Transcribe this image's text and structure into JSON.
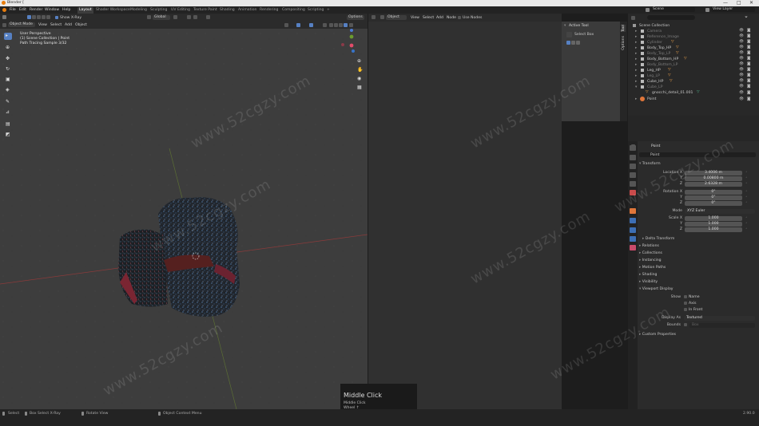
{
  "window": {
    "title": "Blender [",
    "controls": [
      "—",
      "□",
      "✕"
    ]
  },
  "menu": {
    "items": [
      "File",
      "Edit",
      "Render",
      "Window",
      "Help"
    ],
    "workspaces": [
      "Layout",
      "Shader Workspace",
      "Modeling",
      "Sculpting",
      "UV Editing",
      "Texture Paint",
      "Shading",
      "Animation",
      "Rendering",
      "Compositing",
      "Scripting",
      "+"
    ],
    "scene": "Scene",
    "view_layer": "View Layer"
  },
  "toolsettings": {
    "show_xray": "Show X-Ray",
    "transform": "Global",
    "options": "Options"
  },
  "viewport": {
    "mode": "Object Mode",
    "menus": [
      "View",
      "Select",
      "Add",
      "Object"
    ],
    "overlay_lines": [
      "User Perspective",
      "(1) Scene Collection | Point",
      "Path Tracing Sample 3/32"
    ]
  },
  "editor2": {
    "mode": "Object",
    "menus": [
      "View",
      "Select",
      "Add",
      "Node"
    ],
    "use_nodes": "Use Nodes"
  },
  "active_tool": {
    "title": "Active Tool",
    "tool_name": "Select Box",
    "tabs": [
      "Tool",
      "Options"
    ]
  },
  "outliner": {
    "items": [
      {
        "name": "Scene Collection",
        "depth": 0
      },
      {
        "name": "Camera",
        "depth": 1
      },
      {
        "name": "Reference_Image",
        "depth": 1
      },
      {
        "name": "Cylinder",
        "depth": 1
      },
      {
        "name": "Body_Top_HP",
        "depth": 1
      },
      {
        "name": "Body_Top_LP",
        "depth": 1
      },
      {
        "name": "Body_Bottom_HP",
        "depth": 1
      },
      {
        "name": "Body_Bottom_LP",
        "depth": 1
      },
      {
        "name": "Leg_HP",
        "depth": 1
      },
      {
        "name": "Leg_LP",
        "depth": 1
      },
      {
        "name": "Cube_HP",
        "depth": 1
      },
      {
        "name": "Cube_LP",
        "depth": 1
      },
      {
        "name": "gnocchi_detail_01.001",
        "depth": 2
      },
      {
        "name": "Point",
        "depth": 0
      }
    ]
  },
  "properties": {
    "object_name": "Point",
    "sections": {
      "transform": "Transform",
      "delta": "Delta Transform",
      "relations": "Relations",
      "collections": "Collections",
      "instancing": "Instancing",
      "motion_paths": "Motion Paths",
      "shading": "Shading",
      "visibility": "Visibility",
      "viewport_display": "Viewport Display",
      "custom_props": "Custom Properties"
    },
    "location_label": "Location X",
    "location": [
      "3.4006 m",
      "0.00800 m",
      "2.6328 m"
    ],
    "rotation_label": "Rotation X",
    "rotation": [
      "0°",
      "0°",
      "0°"
    ],
    "mode_label": "Mode",
    "mode_value": "XYZ Euler",
    "scale_label": "Scale X",
    "scale": [
      "1.000",
      "1.000",
      "1.000"
    ],
    "axis_y": "Y",
    "axis_z": "Z",
    "show_label": "Show",
    "show_opts": [
      "Name",
      "Axis",
      "In Front"
    ],
    "display_as_label": "Display As",
    "display_as_value": "Textured",
    "bounds_label": "Bounds",
    "bounds_value": "Box"
  },
  "keypop": {
    "title": "Middle Click",
    "lines": [
      "Middle Click",
      "Wheel ↑",
      "Z"
    ]
  },
  "status": {
    "items": [
      "Select",
      "Box Select X-Ray",
      "Rotate View",
      "Object Context Menu"
    ],
    "version": "2.90.0"
  },
  "watermark": "www.52cgzy.com"
}
